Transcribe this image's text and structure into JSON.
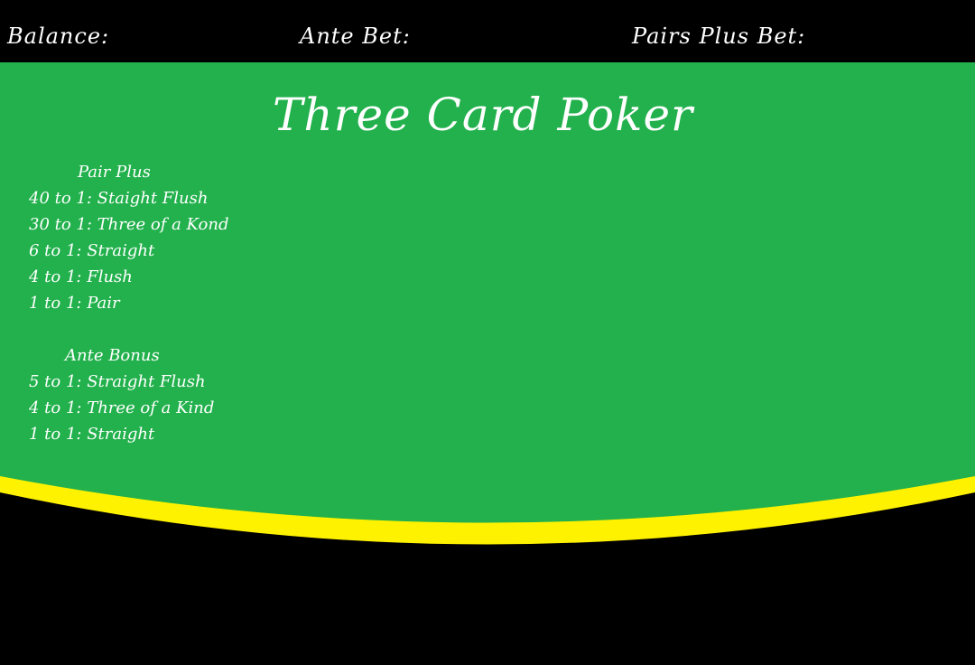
{
  "header": {
    "balance_label": "Balance:",
    "ante_bet_label": "Ante Bet:",
    "pairs_plus_bet_label": "Pairs Plus Bet:"
  },
  "title": "Three Card Poker",
  "pair_plus": {
    "heading": "Pair Plus",
    "rows": [
      "40 to 1: Staight Flush",
      "30 to 1: Three of a Kond",
      "6 to 1: Straight",
      "4 to 1: Flush",
      "1 to 1: Pair"
    ]
  },
  "ante_bonus": {
    "heading": "Ante Bonus",
    "rows": [
      "5 to 1: Straight Flush",
      "4 to 1: Three of a Kind",
      "1 to 1: Straight"
    ]
  },
  "colors": {
    "felt": "#22b14c",
    "rail": "#fff200",
    "background": "#000000",
    "text": "#ffffff"
  }
}
